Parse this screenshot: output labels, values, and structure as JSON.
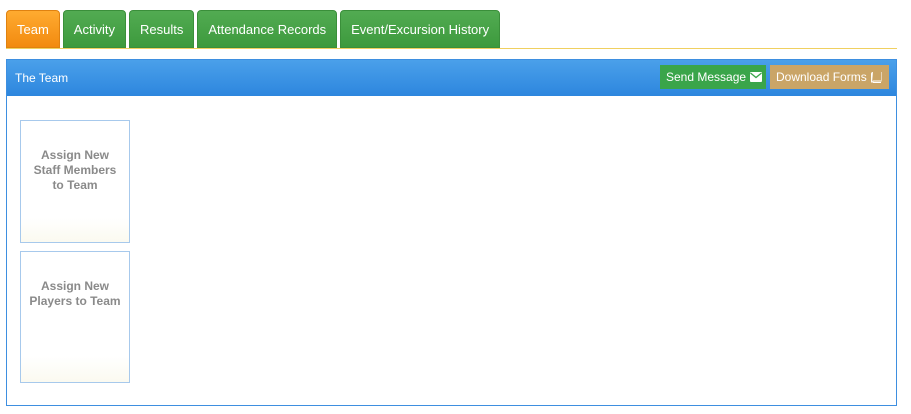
{
  "tabs": [
    {
      "label": "Team",
      "active": true
    },
    {
      "label": "Activity",
      "active": false
    },
    {
      "label": "Results",
      "active": false
    },
    {
      "label": "Attendance Records",
      "active": false
    },
    {
      "label": "Event/Excursion History",
      "active": false
    }
  ],
  "panel": {
    "title": "The Team",
    "send_message_label": "Send Message",
    "send_message_icon": "envelope-icon",
    "download_forms_label": "Download Forms",
    "download_forms_icon": "book-icon"
  },
  "tiles": {
    "assign_staff_label": "Assign New Staff Members to Team",
    "assign_players_label": "Assign New Players to Team"
  },
  "colors": {
    "active_tab": "#f7941d",
    "tab": "#46a046",
    "panel_header": "#348ce2",
    "send_button": "#3aa54a",
    "download_button": "#caa567"
  }
}
